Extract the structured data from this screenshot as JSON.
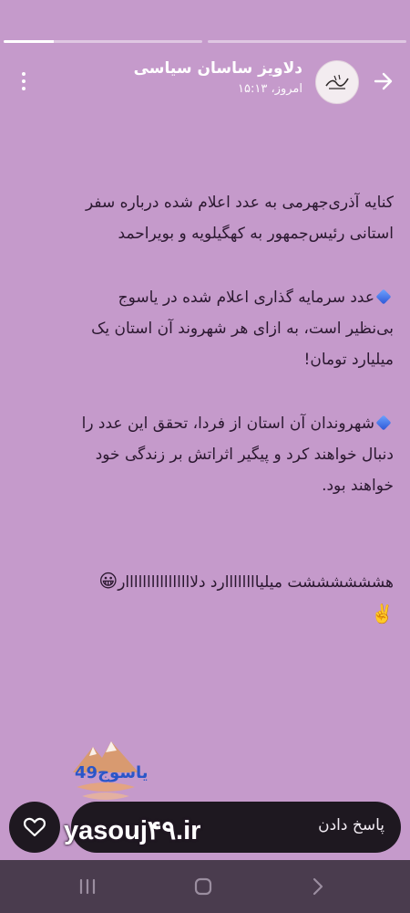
{
  "progress": {
    "segments": [
      {
        "fill": 0.25
      },
      {
        "fill": 0
      }
    ]
  },
  "header": {
    "channel_name": "دلاویز ساسان سیاسی",
    "time": "امروز، ۱۵:۱۳",
    "more_icon": "more-vertical-icon",
    "back_icon": "arrow-forward-icon"
  },
  "post": {
    "p1_line1": "کنایه آذری‌جهرمی به عدد اعلام شده درباره سفر",
    "p1_line2": "استانی رئیس‌جمهور به کهگیلویه و بویراحمد",
    "p2_line1": "عدد سرمایه گذاری اعلام شده در یاسوج",
    "p2_line2": "بی‌نظیر است، به ازای هر شهروند آن استان یک",
    "p2_line3": "میلیارد تومان!",
    "p3_line1": "شهروندان آن استان از فردا، تحقق این عدد را",
    "p3_line2": "دنبال خواهند کرد و پیگیر اثراتش بر زندگی خود",
    "p3_line3": "خواهند بود.",
    "p4_line1": "هششششششت میلیاااااااارد دلاااااااااااااااار",
    "emoji_grin": "😀",
    "emoji_victory": "✌️"
  },
  "watermark": {
    "logo_text": "یاسوج49",
    "url": "yasouj۴۹.ir"
  },
  "footer": {
    "reply_label": "پاسخ دادن",
    "like_icon": "heart-outline-icon"
  },
  "navbar": {
    "recents_icon": "recents-icon",
    "home_icon": "home-icon",
    "back_icon": "nav-back-icon"
  },
  "colors": {
    "background": "#c59acb",
    "bar": "#1e1820",
    "navbar": "#4a3c4e",
    "diamond": "#3d6ee6"
  }
}
